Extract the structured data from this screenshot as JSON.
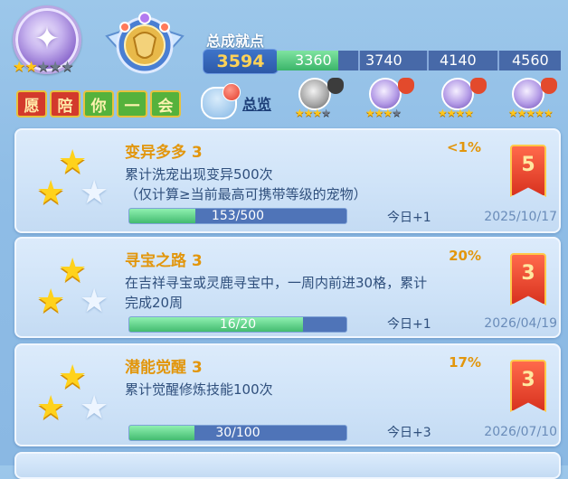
{
  "header": {
    "player_stars": {
      "filled": 2,
      "total": 5
    },
    "name_chars": [
      "愿",
      "陪",
      "你",
      "一",
      "会"
    ],
    "name_tile_colors": [
      "red",
      "red",
      "green",
      "green",
      "green"
    ],
    "total_points_label": "总成就点",
    "total_points": "3594",
    "progress_fraction": 0.215,
    "milestones": [
      "3360",
      "3740",
      "4140",
      "4560"
    ],
    "overview_label": "总览",
    "rewards": [
      {
        "medal": "silver",
        "pouch": "dark",
        "stars": 4
      },
      {
        "medal": "purple",
        "pouch": "red",
        "stars": 4
      },
      {
        "medal": "purple",
        "pouch": "red",
        "stars": 5
      },
      {
        "medal": "purple",
        "pouch": "red",
        "stars": 5
      }
    ]
  },
  "achievements": [
    {
      "title": "变异多多 3",
      "percent": "<1%",
      "desc_line1": "累计洗宠出现变异500次",
      "desc_line2": "（仅计算≥当前最高可携带等级的宠物）",
      "progress_text": "153/500",
      "progress": 0.306,
      "today": "今日+1",
      "date": "2025/10/17",
      "reward_count": "5"
    },
    {
      "title": "寻宝之路 3",
      "percent": "20%",
      "desc_line1": "在吉祥寻宝或灵鹿寻宝中，一周内前进30格，累计",
      "desc_line2": "完成20周",
      "progress_text": "16/20",
      "progress": 0.8,
      "today": "今日+1",
      "date": "2026/04/19",
      "reward_count": "3"
    },
    {
      "title": "潜能觉醒 3",
      "percent": "17%",
      "desc_line1": "累计觉醒修炼技能100次",
      "desc_line2": "",
      "progress_text": "30/100",
      "progress": 0.3,
      "today": "今日+3",
      "date": "2026/07/10",
      "reward_count": "3"
    }
  ],
  "colors": {
    "accent_gold": "#e2960c",
    "progress_green": "#43bb70",
    "bar_blue": "#4f74b8",
    "ribbon_red": "#d8321f"
  }
}
